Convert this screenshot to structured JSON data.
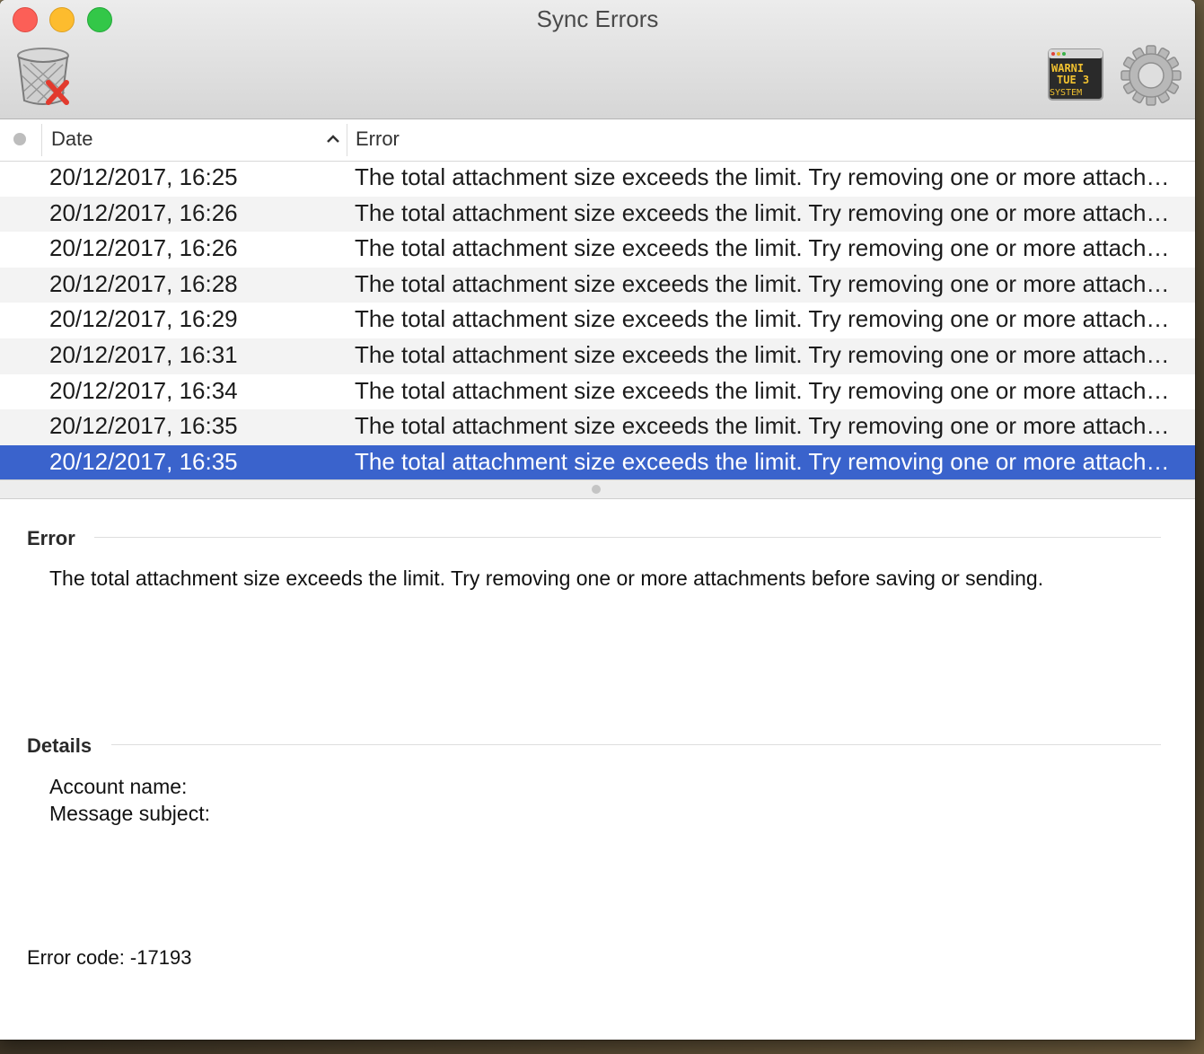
{
  "window": {
    "title": "Sync Errors"
  },
  "toolbar": {
    "delete_icon": "trash-with-red-x-icon",
    "console_icon": "console-warning-icon",
    "console_text": [
      "WARNI",
      "TUE 3",
      "SYSTEM"
    ],
    "settings_icon": "gear-icon"
  },
  "table": {
    "columns": {
      "status": "",
      "date": "Date",
      "error": "Error"
    },
    "sort": {
      "column": "Date",
      "direction": "ascending"
    },
    "rows": [
      {
        "date": "20/12/2017, 16:25",
        "error": "The total attachment size exceeds the limit. Try removing one or more attachments before saving or sending."
      },
      {
        "date": "20/12/2017, 16:26",
        "error": "The total attachment size exceeds the limit. Try removing one or more attachments before saving or sending."
      },
      {
        "date": "20/12/2017, 16:26",
        "error": "The total attachment size exceeds the limit. Try removing one or more attachments before saving or sending."
      },
      {
        "date": "20/12/2017, 16:28",
        "error": "The total attachment size exceeds the limit. Try removing one or more attachments before saving or sending."
      },
      {
        "date": "20/12/2017, 16:29",
        "error": "The total attachment size exceeds the limit. Try removing one or more attachments before saving or sending."
      },
      {
        "date": "20/12/2017, 16:31",
        "error": "The total attachment size exceeds the limit. Try removing one or more attachments before saving or sending."
      },
      {
        "date": "20/12/2017, 16:34",
        "error": "The total attachment size exceeds the limit. Try removing one or more attachments before saving or sending."
      },
      {
        "date": "20/12/2017, 16:35",
        "error": "The total attachment size exceeds the limit. Try removing one or more attachments before saving or sending."
      },
      {
        "date": "20/12/2017, 16:35",
        "error": "The total attachment size exceeds the limit. Try removing one or more attachments before saving or sending."
      }
    ],
    "selected_index": 8
  },
  "detail": {
    "error_heading": "Error",
    "error_text": "The total attachment size exceeds the limit. Try removing one or more attachments before saving or sending.",
    "details_heading": "Details",
    "account_name_label": "Account name:",
    "message_subject_label": "Message subject:",
    "error_code": "Error code: -17193"
  },
  "colors": {
    "selection": "#3a63cc",
    "close": "#fc5f57",
    "minimize": "#fdbc2e",
    "zoom": "#33c748"
  }
}
